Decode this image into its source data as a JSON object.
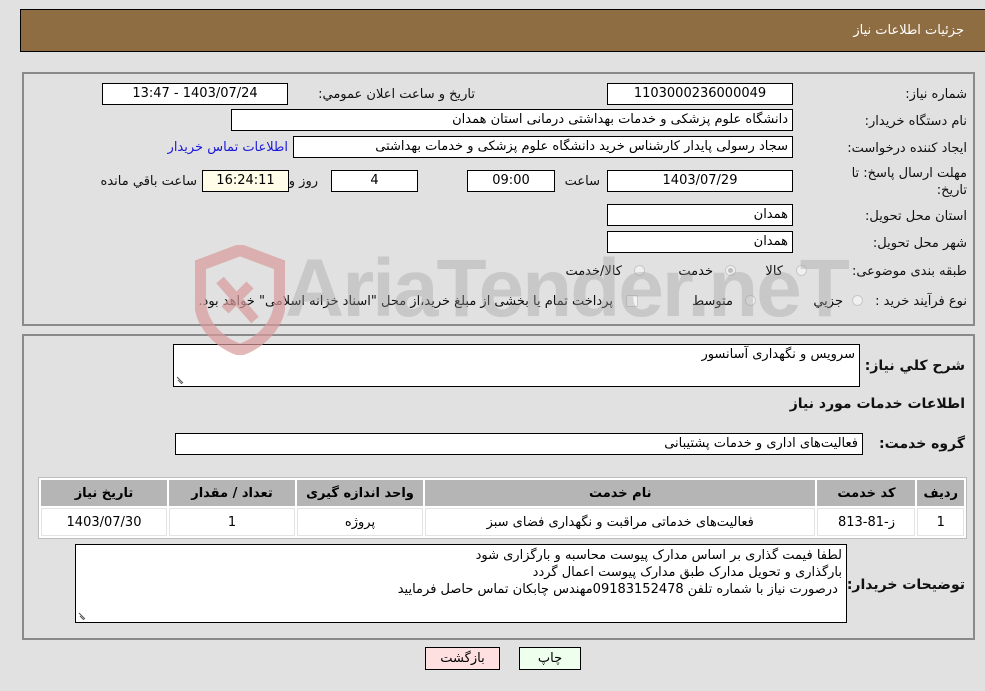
{
  "header": {
    "title": "جزئیات اطلاعات نیاز"
  },
  "details": {
    "need_number": {
      "label": "شماره نیاز:",
      "value": "1103000236000049"
    },
    "announce_datetime": {
      "label": "تاریخ و ساعت اعلان عمومي:",
      "value": "1403/07/24 - 13:47"
    },
    "buyer_org": {
      "label": "نام دستگاه خریدار:",
      "value": "دانشگاه علوم پزشکی و خدمات بهداشتی درمانی استان همدان"
    },
    "requester": {
      "label": "ایجاد کننده درخواست:",
      "value": "سجاد رسولی پایدار کارشناس خرید  دانشگاه علوم پزشکی و خدمات بهداشتی"
    },
    "buyer_contact_link": "اطلاعات تماس خریدار",
    "deadline": {
      "label_line1": "مهلت ارسال پاسخ: تا",
      "label_line2": "تاریخ:",
      "date": "1403/07/29",
      "time_label": "ساعت",
      "time": "09:00",
      "days": "4",
      "days_label": "روز و",
      "remaining": "16:24:11",
      "remaining_label": "ساعت باقي مانده"
    },
    "delivery_province": {
      "label": "استان محل تحویل:",
      "value": "همدان"
    },
    "delivery_city": {
      "label": "شهر محل تحویل:",
      "value": "همدان"
    },
    "category": {
      "label": "طبقه بندی موضوعی:",
      "options": [
        {
          "label": "کالا",
          "checked": false
        },
        {
          "label": "خدمت",
          "checked": true
        },
        {
          "label": "کالا/خدمت",
          "checked": false
        }
      ]
    },
    "purchase_process": {
      "label": "نوع فرآیند خرید :",
      "options": [
        {
          "label": "جزيي",
          "checked": false
        },
        {
          "label": "متوسط",
          "checked": false
        }
      ],
      "treasury_checkbox_label": "پرداخت تمام یا بخشی از مبلغ خرید،از محل \"اسناد خزانه اسلامی\" خواهد بود.",
      "treasury_checked": false
    }
  },
  "summary": {
    "description_label": "شرح کلي نیاز:",
    "description": "سرویس و نگهداری آسانسور",
    "services_heading": "اطلاعات خدمات مورد نیاز",
    "service_group_label": "گروه خدمت:",
    "service_group": "فعالیت‌های اداری و خدمات پشتیبانی"
  },
  "table": {
    "headers": [
      "ردیف",
      "کد خدمت",
      "نام خدمت",
      "واحد اندازه گیری",
      "تعداد / مقدار",
      "تاریخ نیاز"
    ],
    "rows": [
      [
        "1",
        "ز-81-813",
        "فعالیت‌های خدماتی مراقبت و نگهداری فضای سبز",
        "پروژه",
        "1",
        "1403/07/30"
      ]
    ]
  },
  "buyer_notes": {
    "label": "توضیحات خریدار:",
    "lines": [
      "لطفا فیمت گذاری بر اساس مدارک پیوست محاسبه و بارگزاری شود",
      "بارگذاری و تحویل مدارک طبق مدارک پیوست اعمال گردد",
      " درصورت نیاز با شماره تلفن 09183152478مهندس چابکان تماس حاصل فرمایید"
    ]
  },
  "buttons": {
    "print": "چاپ",
    "back": "بازگشت"
  },
  "watermark": {
    "text": "AriaTender.neT"
  },
  "colors": {
    "header_bg": "#8e6d42",
    "print_bg": "#eeffee",
    "back_bg": "#ffe0e0",
    "link": "#1a1ad8"
  }
}
